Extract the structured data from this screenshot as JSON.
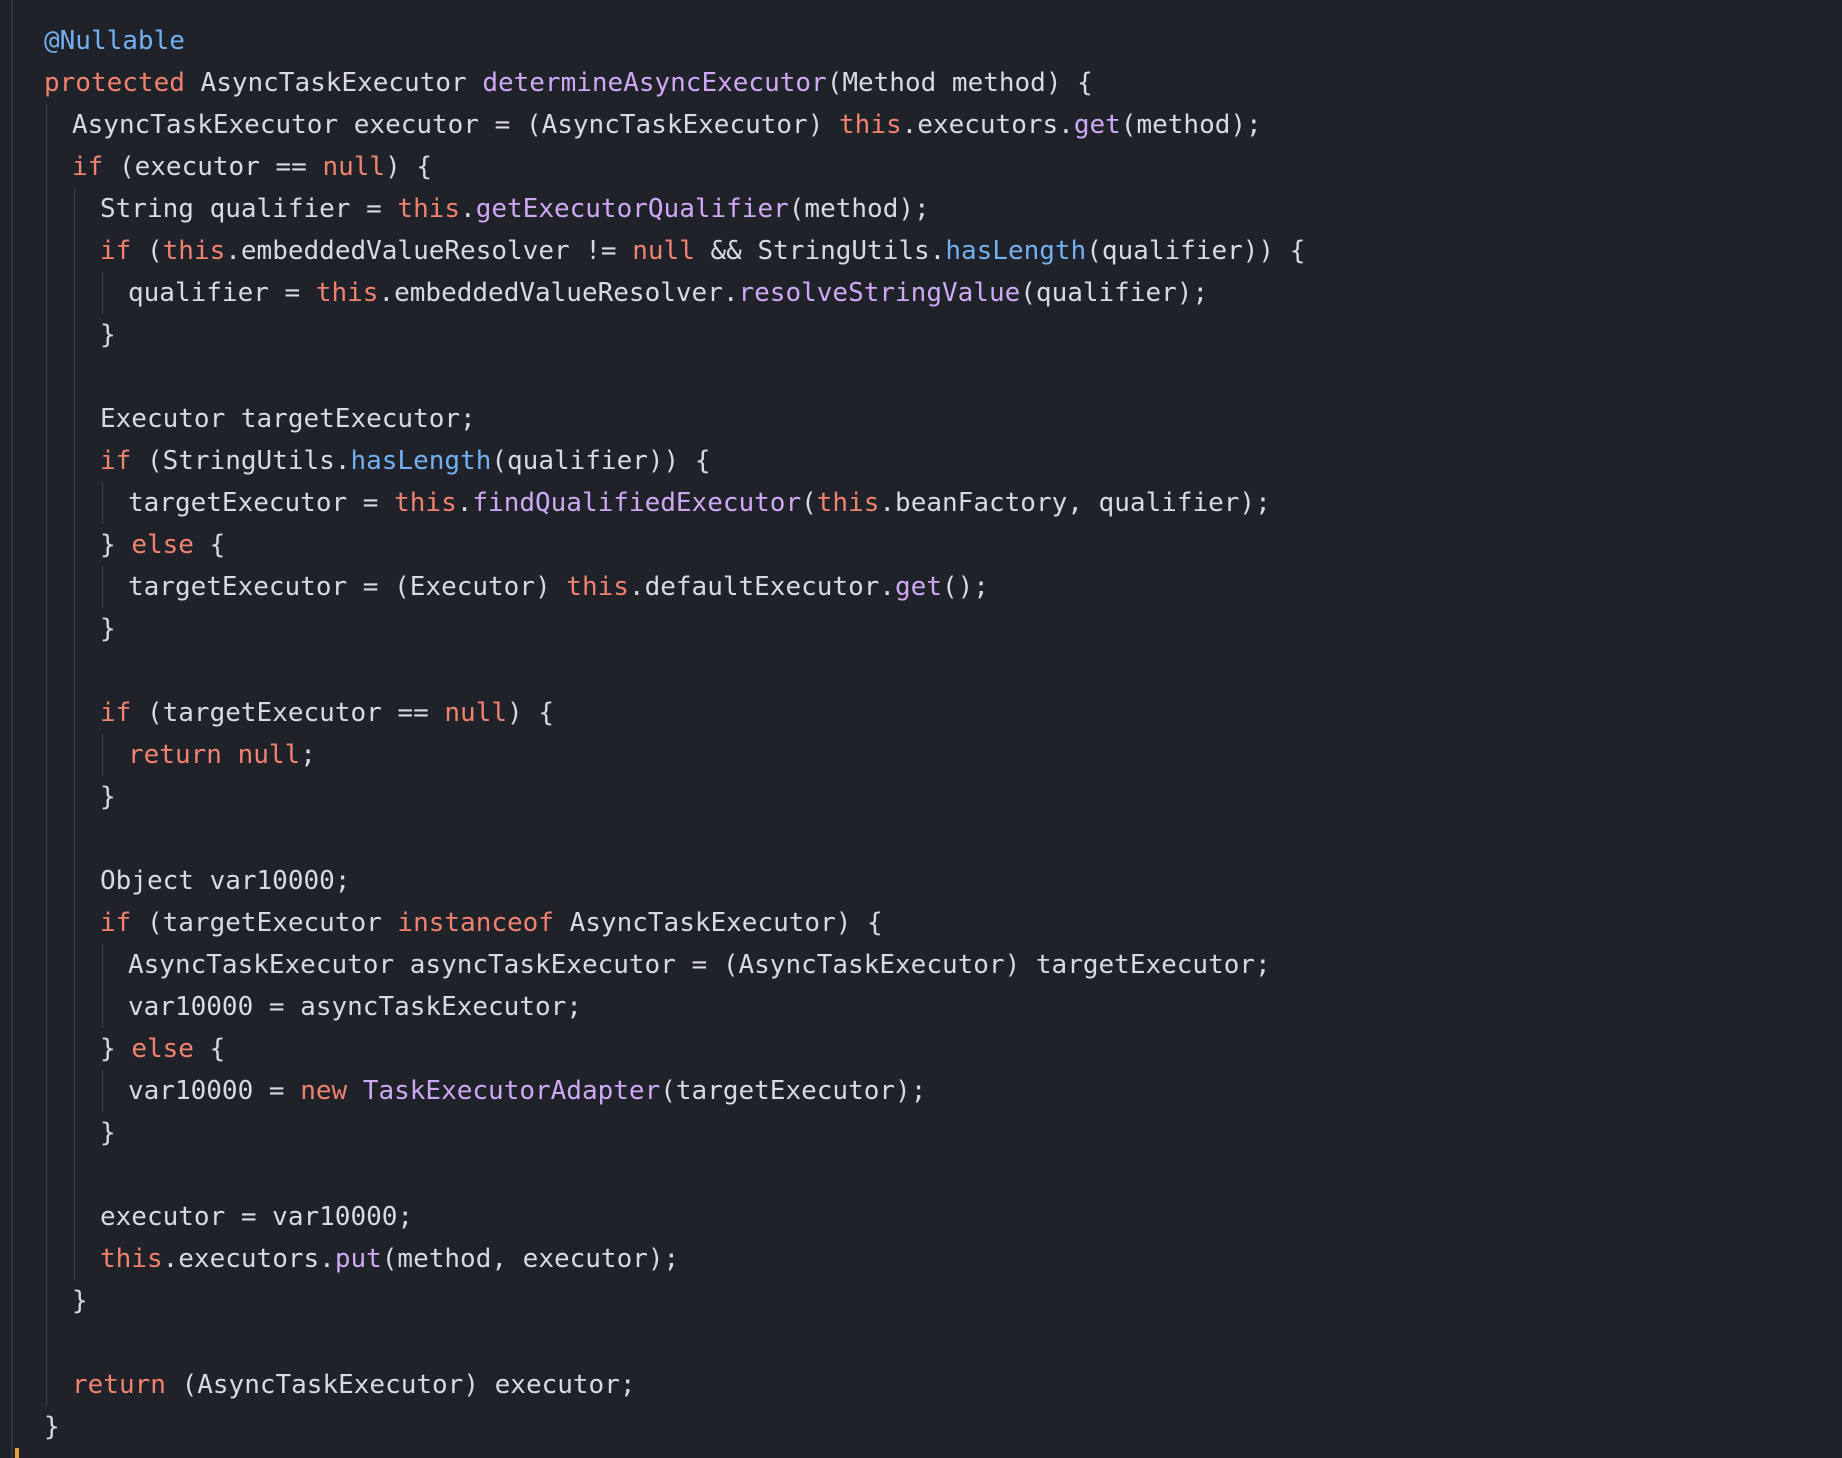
{
  "editor": {
    "theme_colors": {
      "background": "#1f2228",
      "text": "#d7dae0",
      "keyword": "#f0826f",
      "method": "#cfa8f5",
      "static_call": "#72b0f2",
      "annotation": "#72b0f2",
      "cursor": "#e8a23c"
    },
    "lines": [
      {
        "indent": 0,
        "tokens": [
          {
            "t": "@Nullable",
            "c": "anno"
          }
        ]
      },
      {
        "indent": 0,
        "tokens": [
          {
            "t": "protected",
            "c": "kw"
          },
          {
            "t": " AsyncTaskExecutor ",
            "c": "plain"
          },
          {
            "t": "determineAsyncExecutor",
            "c": "fn"
          },
          {
            "t": "(Method method) {",
            "c": "plain"
          }
        ]
      },
      {
        "indent": 1,
        "tokens": [
          {
            "t": "AsyncTaskExecutor executor = (AsyncTaskExecutor) ",
            "c": "plain"
          },
          {
            "t": "this",
            "c": "kw"
          },
          {
            "t": ".executors.",
            "c": "plain"
          },
          {
            "t": "get",
            "c": "fn"
          },
          {
            "t": "(method);",
            "c": "plain"
          }
        ]
      },
      {
        "indent": 1,
        "tokens": [
          {
            "t": "if",
            "c": "kw"
          },
          {
            "t": " (executor == ",
            "c": "plain"
          },
          {
            "t": "null",
            "c": "kw"
          },
          {
            "t": ") {",
            "c": "plain"
          }
        ]
      },
      {
        "indent": 2,
        "tokens": [
          {
            "t": "String qualifier = ",
            "c": "plain"
          },
          {
            "t": "this",
            "c": "kw"
          },
          {
            "t": ".",
            "c": "plain"
          },
          {
            "t": "getExecutorQualifier",
            "c": "fn"
          },
          {
            "t": "(method);",
            "c": "plain"
          }
        ]
      },
      {
        "indent": 2,
        "tokens": [
          {
            "t": "if",
            "c": "kw"
          },
          {
            "t": " (",
            "c": "plain"
          },
          {
            "t": "this",
            "c": "kw"
          },
          {
            "t": ".embeddedValueResolver != ",
            "c": "plain"
          },
          {
            "t": "null",
            "c": "kw"
          },
          {
            "t": " && StringUtils.",
            "c": "plain"
          },
          {
            "t": "hasLength",
            "c": "call-blue"
          },
          {
            "t": "(qualifier)) {",
            "c": "plain"
          }
        ]
      },
      {
        "indent": 3,
        "tokens": [
          {
            "t": "qualifier = ",
            "c": "plain"
          },
          {
            "t": "this",
            "c": "kw"
          },
          {
            "t": ".embeddedValueResolver.",
            "c": "plain"
          },
          {
            "t": "resolveStringValue",
            "c": "fn"
          },
          {
            "t": "(qualifier);",
            "c": "plain"
          }
        ]
      },
      {
        "indent": 2,
        "tokens": [
          {
            "t": "}",
            "c": "plain"
          }
        ]
      },
      {
        "indent": 2,
        "tokens": []
      },
      {
        "indent": 2,
        "tokens": [
          {
            "t": "Executor targetExecutor;",
            "c": "plain"
          }
        ]
      },
      {
        "indent": 2,
        "tokens": [
          {
            "t": "if",
            "c": "kw"
          },
          {
            "t": " (StringUtils.",
            "c": "plain"
          },
          {
            "t": "hasLength",
            "c": "call-blue"
          },
          {
            "t": "(qualifier)) {",
            "c": "plain"
          }
        ]
      },
      {
        "indent": 3,
        "tokens": [
          {
            "t": "targetExecutor = ",
            "c": "plain"
          },
          {
            "t": "this",
            "c": "kw"
          },
          {
            "t": ".",
            "c": "plain"
          },
          {
            "t": "findQualifiedExecutor",
            "c": "fn"
          },
          {
            "t": "(",
            "c": "plain"
          },
          {
            "t": "this",
            "c": "kw"
          },
          {
            "t": ".beanFactory, qualifier);",
            "c": "plain"
          }
        ]
      },
      {
        "indent": 2,
        "tokens": [
          {
            "t": "} ",
            "c": "plain"
          },
          {
            "t": "else",
            "c": "kw"
          },
          {
            "t": " {",
            "c": "plain"
          }
        ]
      },
      {
        "indent": 3,
        "tokens": [
          {
            "t": "targetExecutor = (Executor) ",
            "c": "plain"
          },
          {
            "t": "this",
            "c": "kw"
          },
          {
            "t": ".defaultExecutor.",
            "c": "plain"
          },
          {
            "t": "get",
            "c": "fn"
          },
          {
            "t": "();",
            "c": "plain"
          }
        ]
      },
      {
        "indent": 2,
        "tokens": [
          {
            "t": "}",
            "c": "plain"
          }
        ]
      },
      {
        "indent": 2,
        "tokens": []
      },
      {
        "indent": 2,
        "tokens": [
          {
            "t": "if",
            "c": "kw"
          },
          {
            "t": " (targetExecutor == ",
            "c": "plain"
          },
          {
            "t": "null",
            "c": "kw"
          },
          {
            "t": ") {",
            "c": "plain"
          }
        ]
      },
      {
        "indent": 3,
        "tokens": [
          {
            "t": "return",
            "c": "kw"
          },
          {
            "t": " ",
            "c": "plain"
          },
          {
            "t": "null",
            "c": "kw"
          },
          {
            "t": ";",
            "c": "plain"
          }
        ]
      },
      {
        "indent": 2,
        "tokens": [
          {
            "t": "}",
            "c": "plain"
          }
        ]
      },
      {
        "indent": 2,
        "tokens": []
      },
      {
        "indent": 2,
        "tokens": [
          {
            "t": "Object var10000;",
            "c": "plain"
          }
        ]
      },
      {
        "indent": 2,
        "tokens": [
          {
            "t": "if",
            "c": "kw"
          },
          {
            "t": " (targetExecutor ",
            "c": "plain"
          },
          {
            "t": "instanceof",
            "c": "kw"
          },
          {
            "t": " AsyncTaskExecutor) {",
            "c": "plain"
          }
        ]
      },
      {
        "indent": 3,
        "tokens": [
          {
            "t": "AsyncTaskExecutor asyncTaskExecutor = (AsyncTaskExecutor) targetExecutor;",
            "c": "plain"
          }
        ]
      },
      {
        "indent": 3,
        "tokens": [
          {
            "t": "var10000 = asyncTaskExecutor;",
            "c": "plain"
          }
        ]
      },
      {
        "indent": 2,
        "tokens": [
          {
            "t": "} ",
            "c": "plain"
          },
          {
            "t": "else",
            "c": "kw"
          },
          {
            "t": " {",
            "c": "plain"
          }
        ]
      },
      {
        "indent": 3,
        "tokens": [
          {
            "t": "var10000 = ",
            "c": "plain"
          },
          {
            "t": "new",
            "c": "kw"
          },
          {
            "t": " ",
            "c": "plain"
          },
          {
            "t": "TaskExecutorAdapter",
            "c": "fn"
          },
          {
            "t": "(targetExecutor);",
            "c": "plain"
          }
        ]
      },
      {
        "indent": 2,
        "tokens": [
          {
            "t": "}",
            "c": "plain"
          }
        ]
      },
      {
        "indent": 2,
        "tokens": []
      },
      {
        "indent": 2,
        "tokens": [
          {
            "t": "executor = var10000;",
            "c": "plain"
          }
        ]
      },
      {
        "indent": 2,
        "tokens": [
          {
            "t": "this",
            "c": "kw"
          },
          {
            "t": ".executors.",
            "c": "plain"
          },
          {
            "t": "put",
            "c": "fn"
          },
          {
            "t": "(method, executor);",
            "c": "plain"
          }
        ]
      },
      {
        "indent": 1,
        "tokens": [
          {
            "t": "}",
            "c": "plain"
          }
        ]
      },
      {
        "indent": 1,
        "tokens": []
      },
      {
        "indent": 1,
        "tokens": [
          {
            "t": "return",
            "c": "kw"
          },
          {
            "t": " (AsyncTaskExecutor) executor;",
            "c": "plain"
          }
        ]
      },
      {
        "indent": 0,
        "tokens": [
          {
            "t": "}",
            "c": "plain"
          }
        ]
      }
    ]
  }
}
